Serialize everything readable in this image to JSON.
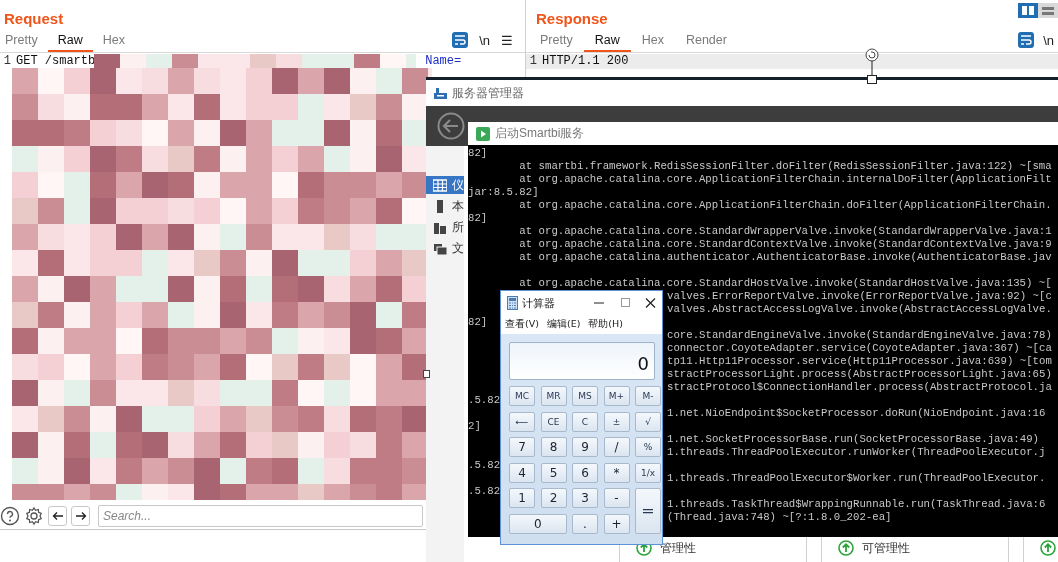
{
  "request": {
    "title": "Request",
    "tabs": [
      {
        "label": "Pretty",
        "selected": false
      },
      {
        "label": "Raw",
        "selected": true
      },
      {
        "label": "Hex",
        "selected": false
      }
    ],
    "tools": {
      "newline": "\\n",
      "menu": "☰"
    },
    "lines": [
      {
        "number": "1",
        "text": "GET /smartb",
        "tail": "Name="
      }
    ],
    "search": {
      "placeholder": "Search..."
    }
  },
  "response": {
    "title": "Response",
    "layout_toggle": [
      {
        "kind": "columns",
        "selected": true
      },
      {
        "kind": "rows",
        "selected": false
      }
    ],
    "tabs": [
      {
        "label": "Pretty",
        "selected": false
      },
      {
        "label": "Raw",
        "selected": true
      },
      {
        "label": "Hex",
        "selected": false
      },
      {
        "label": "Render",
        "selected": false
      }
    ],
    "tools": {
      "newline": "\\n"
    },
    "lines": [
      {
        "number": "1",
        "text": "HTTP/1.1 200",
        "highlighted": true
      }
    ]
  },
  "server_manager": {
    "title": "服务器管理器",
    "sidebar": [
      {
        "label": "仪",
        "kind": "dashboard",
        "selected": true
      },
      {
        "label": "本",
        "kind": "server",
        "selected": false
      },
      {
        "label": "所",
        "kind": "servers",
        "selected": false
      },
      {
        "label": "文",
        "kind": "files",
        "selected": false
      }
    ],
    "tiles": [
      {
        "label": "管理性"
      },
      {
        "label": "可管理性"
      }
    ]
  },
  "console": {
    "title": "启动Smartbi服务",
    "lines": [
      {
        "kind": "full",
        "text": "82]"
      },
      {
        "kind": "full",
        "text": "        at smartbi.framework.RedisSessionFilter.doFilter(RedisSessionFilter.java:122) ~[sma"
      },
      {
        "kind": "full",
        "text": "        at org.apache.catalina.core.ApplicationFilterChain.internalDoFilter(ApplicationFilt"
      },
      {
        "kind": "full",
        "text": "jar:8.5.82]"
      },
      {
        "kind": "full",
        "text": "        at org.apache.catalina.core.ApplicationFilterChain.doFilter(ApplicationFilterChain."
      },
      {
        "kind": "full",
        "text": "82]"
      },
      {
        "kind": "full",
        "text": "        at org.apache.catalina.core.StandardWrapperValve.invoke(StandardWrapperValve.java:1"
      },
      {
        "kind": "full",
        "text": "        at org.apache.catalina.core.StandardContextValve.invoke(StandardContextValve.java:9"
      },
      {
        "kind": "full",
        "text": "        at org.apache.catalina.authenticator.AuthenticatorBase.invoke(AuthenticatorBase.jav"
      },
      {
        "kind": "blank"
      },
      {
        "kind": "full",
        "text": "        at org.apache.catalina.core.StandardHostValve.invoke(StandardHostValve.java:135) ~["
      },
      {
        "kind": "split",
        "right": "valves.ErrorReportValve.invoke(ErrorReportValve.java:92) ~[c"
      },
      {
        "kind": "split",
        "right": "valves.AbstractAccessLogValve.invoke(AbstractAccessLogValve."
      },
      {
        "kind": "split",
        "left": "82]"
      },
      {
        "kind": "split",
        "right": "core.StandardEngineValve.invoke(StandardEngineValve.java:78)"
      },
      {
        "kind": "split",
        "right": "connector.CoyoteAdapter.service(CoyoteAdapter.java:367) ~[ca"
      },
      {
        "kind": "split",
        "right": "tp11.Http11Processor.service(Http11Processor.java:639) ~[tom"
      },
      {
        "kind": "split",
        "right": "stractProcessorLight.process(AbstractProcessorLight.java:65)"
      },
      {
        "kind": "split",
        "right": "stractProtocol$ConnectionHandler.process(AbstractProtocol.ja"
      },
      {
        "kind": "split",
        "left": ".5.82"
      },
      {
        "kind": "split",
        "right": "1.net.NioEndpoint$SocketProcessor.doRun(NioEndpoint.java:16"
      },
      {
        "kind": "split",
        "left": "2]"
      },
      {
        "kind": "split",
        "right": "1.net.SocketProcessorBase.run(SocketProcessorBase.java:49)"
      },
      {
        "kind": "split",
        "right": "1.threads.ThreadPoolExecutor.runWorker(ThreadPoolExecutor.j"
      },
      {
        "kind": "split",
        "left": ".5.82"
      },
      {
        "kind": "split",
        "right": "1.threads.ThreadPoolExecutor$Worker.run(ThreadPoolExecutor."
      },
      {
        "kind": "split",
        "left": ".5.82"
      },
      {
        "kind": "split",
        "right": "1.threads.TaskThread$WrappingRunnable.run(TaskThread.java:6"
      },
      {
        "kind": "split",
        "right": "(Thread.java:748) ~[?:1.8.0_202-ea]"
      }
    ]
  },
  "calculator": {
    "title": "计算器",
    "menu": [
      "查看(V)",
      "编辑(E)",
      "帮助(H)"
    ],
    "display": "0",
    "keys": [
      {
        "label": "MC",
        "kind": "normal"
      },
      {
        "label": "MR",
        "kind": "normal"
      },
      {
        "label": "MS",
        "kind": "normal"
      },
      {
        "label": "M+",
        "kind": "normal"
      },
      {
        "label": "M-",
        "kind": "normal"
      },
      {
        "label": "⟵",
        "kind": "normal"
      },
      {
        "label": "CE",
        "kind": "normal"
      },
      {
        "label": "C",
        "kind": "normal"
      },
      {
        "label": "±",
        "kind": "normal"
      },
      {
        "label": "√",
        "kind": "normal"
      },
      {
        "label": "7",
        "kind": "normal"
      },
      {
        "label": "8",
        "kind": "normal"
      },
      {
        "label": "9",
        "kind": "normal"
      },
      {
        "label": "/",
        "kind": "normal"
      },
      {
        "label": "%",
        "kind": "normal"
      },
      {
        "label": "4",
        "kind": "normal"
      },
      {
        "label": "5",
        "kind": "normal"
      },
      {
        "label": "6",
        "kind": "normal"
      },
      {
        "label": "*",
        "kind": "normal"
      },
      {
        "label": "1/x",
        "kind": "normal"
      },
      {
        "label": "1",
        "kind": "normal"
      },
      {
        "label": "2",
        "kind": "normal"
      },
      {
        "label": "3",
        "kind": "normal"
      },
      {
        "label": "-",
        "kind": "normal"
      },
      {
        "label": "=",
        "kind": "tall"
      },
      {
        "label": "0",
        "kind": "wide"
      },
      {
        "label": ".",
        "kind": "normal"
      },
      {
        "label": "+",
        "kind": "normal"
      }
    ]
  }
}
